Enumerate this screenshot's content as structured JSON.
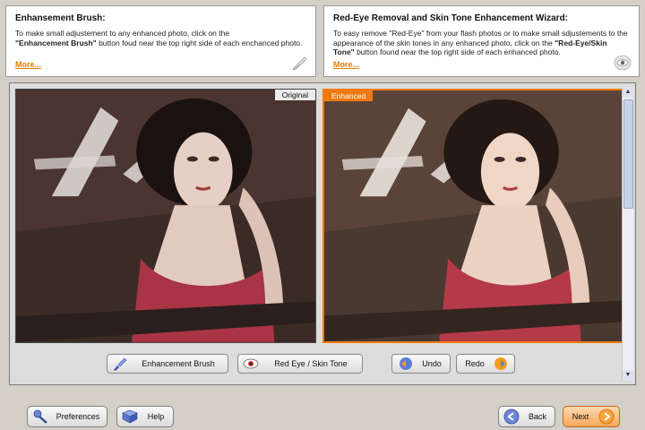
{
  "info_left": {
    "title": "Enhansement Brush:",
    "text_part1": "To make small adjustement to any enhanced photo, click on the",
    "text_bold": "\"Enhancement Brush\"",
    "text_part2": " button foud near the top right side of each enchanced photo.",
    "more": "More..."
  },
  "info_right": {
    "title": "Red-Eye Removal and Skin Tone Enhancement Wizard:",
    "text_part1": "To easy remove \"Red-Eye\" from your flash photos or to make small sdjustements to the appearance of the skin tones in any enhanced photo, click on the ",
    "text_bold": "\"Red-Eye/Skin Tone\"",
    "text_part2": " button found near the top right side of each enhanced photo.",
    "more": "More..."
  },
  "photos": {
    "original_label": "Original",
    "enhanced_label": "Enhanced"
  },
  "toolbar": {
    "enhancement_brush": "Enhancement Brush",
    "red_eye": "Red Eye / Skin Tone",
    "undo": "Undo",
    "redo": "Redo"
  },
  "footer": {
    "preferences": "Preferences",
    "help": "Help",
    "back": "Back",
    "next": "Next"
  },
  "colors": {
    "accent": "#f07a10",
    "link": "#e87a00",
    "panel_bg": "#d4d0c8"
  },
  "icons": [
    "brush-icon",
    "eye-icon",
    "undo-icon",
    "redo-icon",
    "preferences-icon",
    "help-book-icon",
    "back-arrow-icon",
    "next-arrow-icon"
  ]
}
